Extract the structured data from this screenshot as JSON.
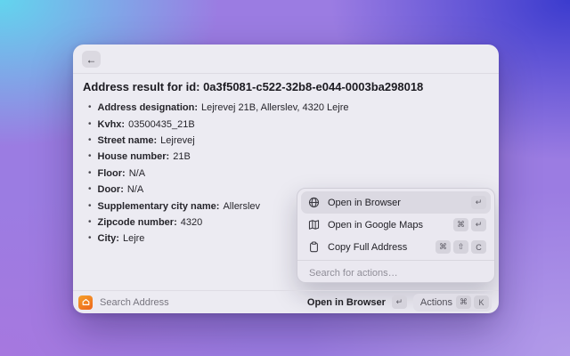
{
  "background": {
    "corner_colors": {
      "top_left": "#62d5ee",
      "top_right": "#3b3bce",
      "bottom_left": "#a678df",
      "bottom_right": "#b29be9"
    }
  },
  "window": {
    "back_button": "←",
    "title": "Address result for id: 0a3f5081-c522-32b8-e044-0003ba298018",
    "fields": [
      {
        "label": "Address designation",
        "value": "Lejrevej 21B, Allerslev, 4320 Lejre"
      },
      {
        "label": "Kvhx",
        "value": "03500435_21B"
      },
      {
        "label": "Street name",
        "value": "Lejrevej"
      },
      {
        "label": "House number",
        "value": "21B"
      },
      {
        "label": "Floor",
        "value": "N/A"
      },
      {
        "label": "Door",
        "value": "N/A"
      },
      {
        "label": "Supplementary city name",
        "value": "Allerslev"
      },
      {
        "label": "Zipcode number",
        "value": "4320"
      },
      {
        "label": "City",
        "value": "Lejre"
      }
    ]
  },
  "actions_panel": {
    "items": [
      {
        "label": "Open in Browser",
        "icon": "globe-icon",
        "keys": [
          "↵"
        ],
        "selected": true
      },
      {
        "label": "Open in Google Maps",
        "icon": "map-icon",
        "keys": [
          "⌘",
          "↵"
        ],
        "selected": false
      },
      {
        "label": "Copy Full Address",
        "icon": "clipboard-icon",
        "keys": [
          "⌘",
          "⇧",
          "C"
        ],
        "selected": false
      }
    ],
    "search_placeholder": "Search for actions…"
  },
  "footer": {
    "app_name": "Search Address",
    "app_icon_color": "#ef7a20",
    "primary_action": "Open in Browser",
    "primary_key": "↵",
    "actions_label": "Actions",
    "actions_keys": [
      "⌘",
      "K"
    ]
  }
}
